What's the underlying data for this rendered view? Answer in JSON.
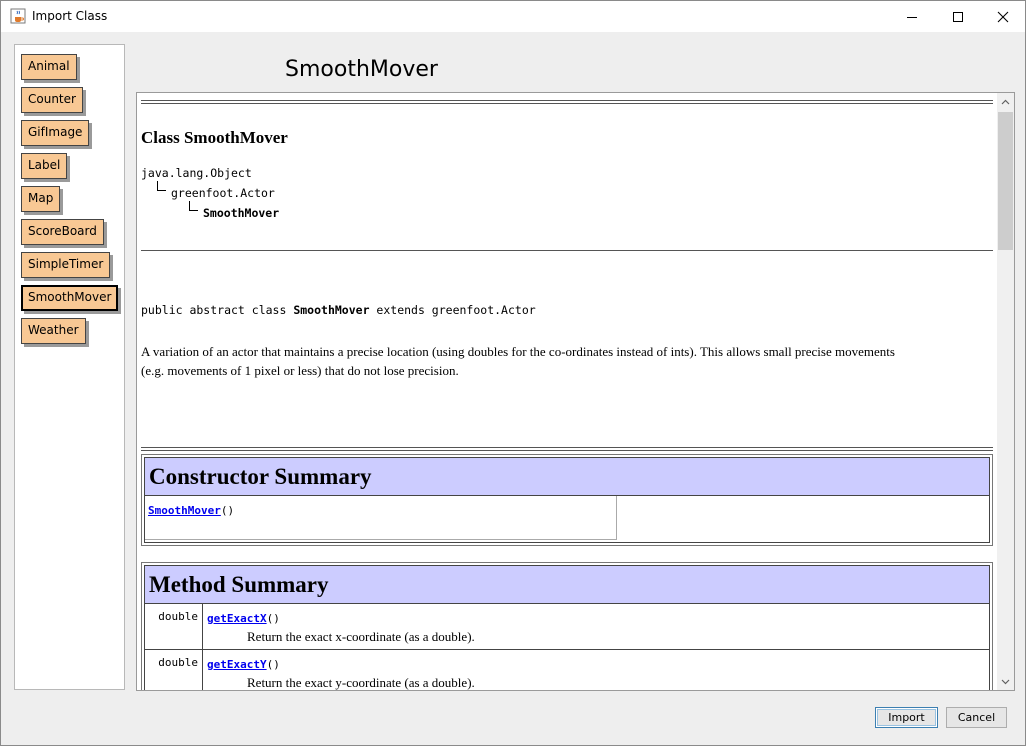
{
  "window": {
    "title": "Import Class"
  },
  "class_list": {
    "items": [
      "Animal",
      "Counter",
      "GifImage",
      "Label",
      "Map",
      "ScoreBoard",
      "SimpleTimer",
      "SmoothMover",
      "Weather"
    ],
    "selected": "SmoothMover"
  },
  "doc": {
    "header_title": "SmoothMover",
    "class_heading": "Class SmoothMover",
    "hierarchy": [
      "java.lang.Object",
      "greenfoot.Actor",
      "SmoothMover"
    ],
    "declaration": {
      "part1": "public abstract class ",
      "name": "SmoothMover",
      "part2": " extends greenfoot.Actor"
    },
    "description_line1": "A variation of an actor that maintains a precise location (using doubles for the co-ordinates instead of ints).  This allows small precise movements",
    "description_line2": "(e.g. movements of 1 pixel or less) that do not lose precision.",
    "constructor_summary": {
      "heading": "Constructor Summary",
      "constructor_name": "SmoothMover",
      "constructor_parens": "()"
    },
    "method_summary": {
      "heading": "Method Summary",
      "methods": [
        {
          "type": "double",
          "name": "getExactX",
          "parens": "()",
          "description": "Return the exact x-coordinate (as a double)."
        },
        {
          "type": "double",
          "name": "getExactY",
          "parens": "()",
          "description": "Return the exact y-coordinate (as a double)."
        }
      ]
    }
  },
  "footer": {
    "import_label": "Import",
    "cancel_label": "Cancel"
  },
  "icons": {
    "app": "java-cup-icon",
    "minimize": "minimize-icon",
    "maximize": "maximize-icon",
    "close": "close-icon"
  },
  "colors": {
    "class_button_fill": "#f8c894",
    "summary_header_fill": "#ccccff",
    "link": "#0000ee"
  }
}
